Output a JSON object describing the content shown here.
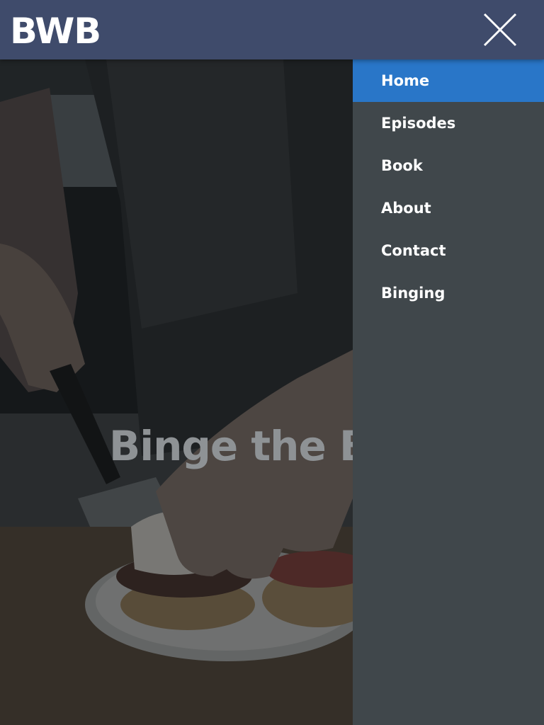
{
  "header": {
    "logo_text": "BWB",
    "close_icon": "close-icon"
  },
  "hero": {
    "title": "Binge the Ba"
  },
  "nav": {
    "items": [
      {
        "label": "Home",
        "active": true
      },
      {
        "label": "Episodes",
        "active": false
      },
      {
        "label": "Book",
        "active": false
      },
      {
        "label": "About",
        "active": false
      },
      {
        "label": "Contact",
        "active": false
      },
      {
        "label": "Binging",
        "active": false
      }
    ]
  },
  "colors": {
    "header_bg": "#3f4b6b",
    "drawer_bg": "#40474b",
    "active_item_bg": "#2976c8",
    "text": "#ffffff"
  }
}
